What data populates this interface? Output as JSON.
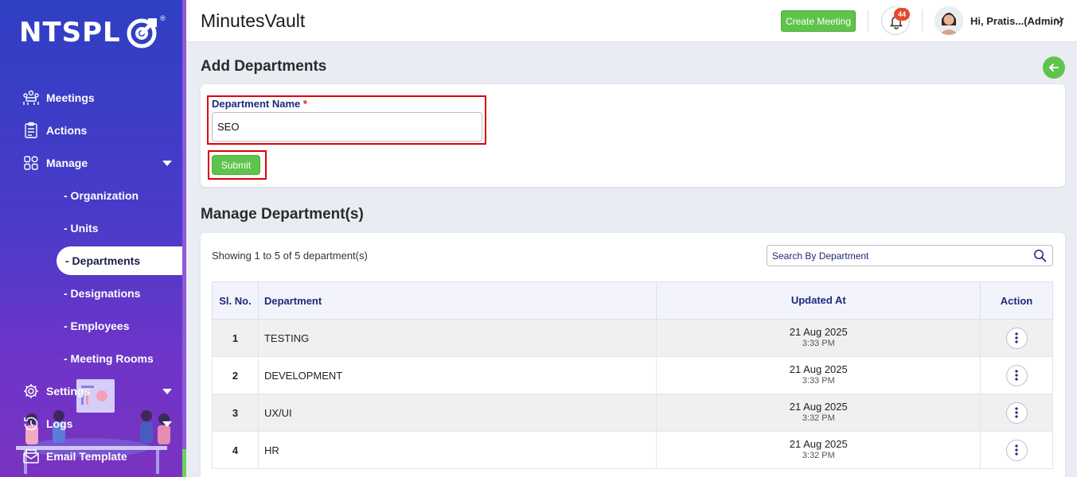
{
  "brand": {
    "logo_text": "NTSPL",
    "logo_reg": "®"
  },
  "header": {
    "app_title": "MinutesVault",
    "create_meeting_label": "Create Meeting",
    "notification_count": "44",
    "user_name": "Hi, Pratis...(Admin)"
  },
  "sidebar": {
    "items": [
      {
        "label": "Meetings",
        "icon": "meetings-icon"
      },
      {
        "label": "Actions",
        "icon": "clipboard-icon"
      },
      {
        "label": "Manage",
        "icon": "grid-icon"
      },
      {
        "label": "Settings",
        "icon": "gear-icon"
      },
      {
        "label": "Logs",
        "icon": "history-icon"
      },
      {
        "label": "Email Template",
        "icon": "mail-icon"
      }
    ],
    "manage_sub": [
      "- Organization",
      "- Units",
      "- Departments",
      "- Designations",
      "- Employees",
      "- Meeting Rooms"
    ],
    "active_sub": "- Departments"
  },
  "add_section": {
    "title": "Add Departments",
    "field_label": "Department Name",
    "required_mark": "*",
    "field_value": "SEO",
    "submit_label": "Submit"
  },
  "manage_section": {
    "title": "Manage Department(s)",
    "showing_text": "Showing 1 to 5 of 5 department(s)",
    "search_placeholder": "Search By Department",
    "columns": [
      "Sl. No.",
      "Department",
      "Updated At",
      "Action"
    ],
    "rows": [
      {
        "sl": "1",
        "department": "TESTING",
        "date": "21 Aug 2025",
        "time": "3:33 PM"
      },
      {
        "sl": "2",
        "department": "DEVELOPMENT",
        "date": "21 Aug 2025",
        "time": "3:33 PM"
      },
      {
        "sl": "3",
        "department": "UX/UI",
        "date": "21 Aug 2025",
        "time": "3:32 PM"
      },
      {
        "sl": "4",
        "department": "HR",
        "date": "21 Aug 2025",
        "time": "3:32 PM"
      }
    ]
  },
  "colors": {
    "accent_green": "#5ec44b",
    "label_navy": "#1d2a7a",
    "highlight_red": "#e00000",
    "badge_red": "#e44b2b"
  }
}
